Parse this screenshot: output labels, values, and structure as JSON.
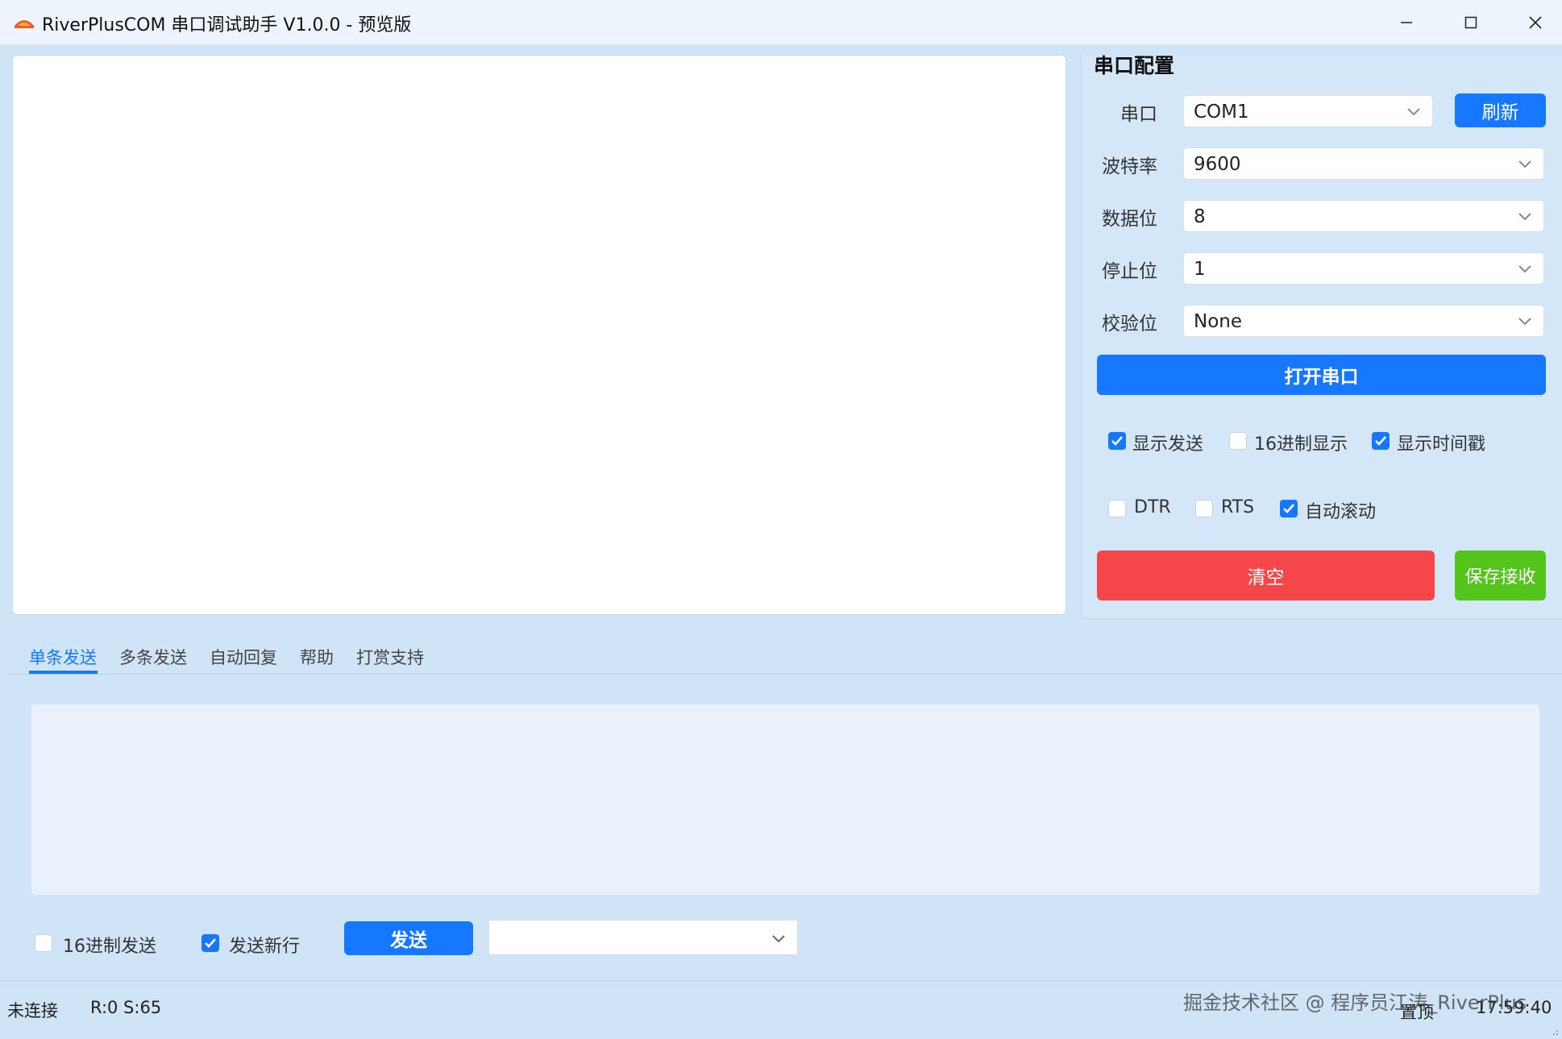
{
  "window": {
    "title": "RiverPlusCOM 串口调试助手 V1.0.0 - 预览版"
  },
  "receive": {
    "content": ""
  },
  "config": {
    "section_title": "串口配置",
    "port": {
      "label": "串口",
      "value": "COM1",
      "refresh_label": "刷新"
    },
    "baud": {
      "label": "波特率",
      "value": "9600"
    },
    "databits": {
      "label": "数据位",
      "value": "8"
    },
    "stopbits": {
      "label": "停止位",
      "value": "1"
    },
    "parity": {
      "label": "校验位",
      "value": "None"
    },
    "open_label": "打开串口",
    "options_row1": [
      {
        "label": "显示发送",
        "checked": true
      },
      {
        "label": "16进制显示",
        "checked": false
      },
      {
        "label": "显示时间戳",
        "checked": true
      }
    ],
    "options_row2": [
      {
        "label": "DTR",
        "checked": false
      },
      {
        "label": "RTS",
        "checked": false
      },
      {
        "label": "自动滚动",
        "checked": true
      }
    ],
    "clear_label": "清空",
    "save_label": "保存接收",
    "colors": {
      "primary": "#1677ff",
      "danger": "#f5474a",
      "success": "#52c41a"
    }
  },
  "tabs": [
    "单条发送",
    "多条发送",
    "自动回复",
    "帮助",
    "打赏支持"
  ],
  "active_tab": "单条发送",
  "send": {
    "content": "",
    "hex_send": {
      "label": "16进制发送",
      "checked": false
    },
    "newline": {
      "label": "发送新行",
      "checked": true
    },
    "send_label": "发送",
    "history_value": ""
  },
  "status": {
    "connection": "未连接",
    "counters": "R:0 S:65",
    "pin_label": "置顶",
    "time": "17:59:40"
  },
  "watermark": "掘金技术社区 @ 程序员江涛_RiverPlus"
}
